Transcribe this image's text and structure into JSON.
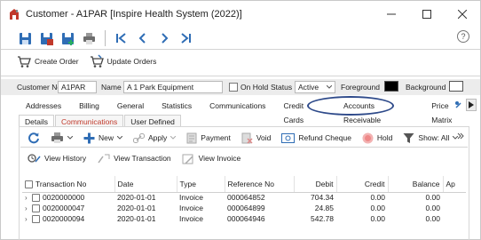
{
  "window": {
    "title": "Customer - A1PAR [Inspire Health System (2022)]"
  },
  "toolbar_actions": {
    "create_order": "Create Order",
    "update_orders": "Update Orders"
  },
  "header": {
    "customer_no_label": "Customer No",
    "customer_no": "A1PAR",
    "name_label": "Name",
    "name": "A 1 Park Equipment",
    "on_hold_label": "On Hold",
    "status_label": "Status",
    "status": "Active",
    "foreground_label": "Foreground",
    "background_label": "Background",
    "foreground_color": "#000000",
    "background_color": "#ffffff"
  },
  "tabs": [
    "Addresses",
    "Billing",
    "General",
    "Statistics",
    "Communications",
    "Credit Cards",
    "Accounts Receivable",
    "Price Matrix"
  ],
  "active_tab": "Accounts Receivable",
  "subtabs": [
    "Details",
    "Communications",
    "User Defined"
  ],
  "ar_toolbar": {
    "new": "New",
    "apply": "Apply",
    "payment": "Payment",
    "void": "Void",
    "refund": "Refund Cheque",
    "hold": "Hold",
    "show": "Show: All"
  },
  "ar_toolbar2": {
    "view_history": "View History",
    "view_transaction": "View Transaction",
    "view_invoice": "View Invoice"
  },
  "grid": {
    "columns": [
      "Transaction No",
      "Date",
      "Type",
      "Reference No",
      "Debit",
      "Credit",
      "Balance",
      "Ap"
    ],
    "rows": [
      {
        "txn": "0020000000",
        "date": "2020-01-01",
        "type": "Invoice",
        "ref": "000064852",
        "debit": "704.34",
        "credit": "0.00",
        "balance": "0.00"
      },
      {
        "txn": "0020000047",
        "date": "2020-01-01",
        "type": "Invoice",
        "ref": "000064899",
        "debit": "24.85",
        "credit": "0.00",
        "balance": "0.00"
      },
      {
        "txn": "0020000094",
        "date": "2020-01-01",
        "type": "Invoice",
        "ref": "000064946",
        "debit": "542.78",
        "credit": "0.00",
        "balance": "0.00"
      }
    ]
  }
}
